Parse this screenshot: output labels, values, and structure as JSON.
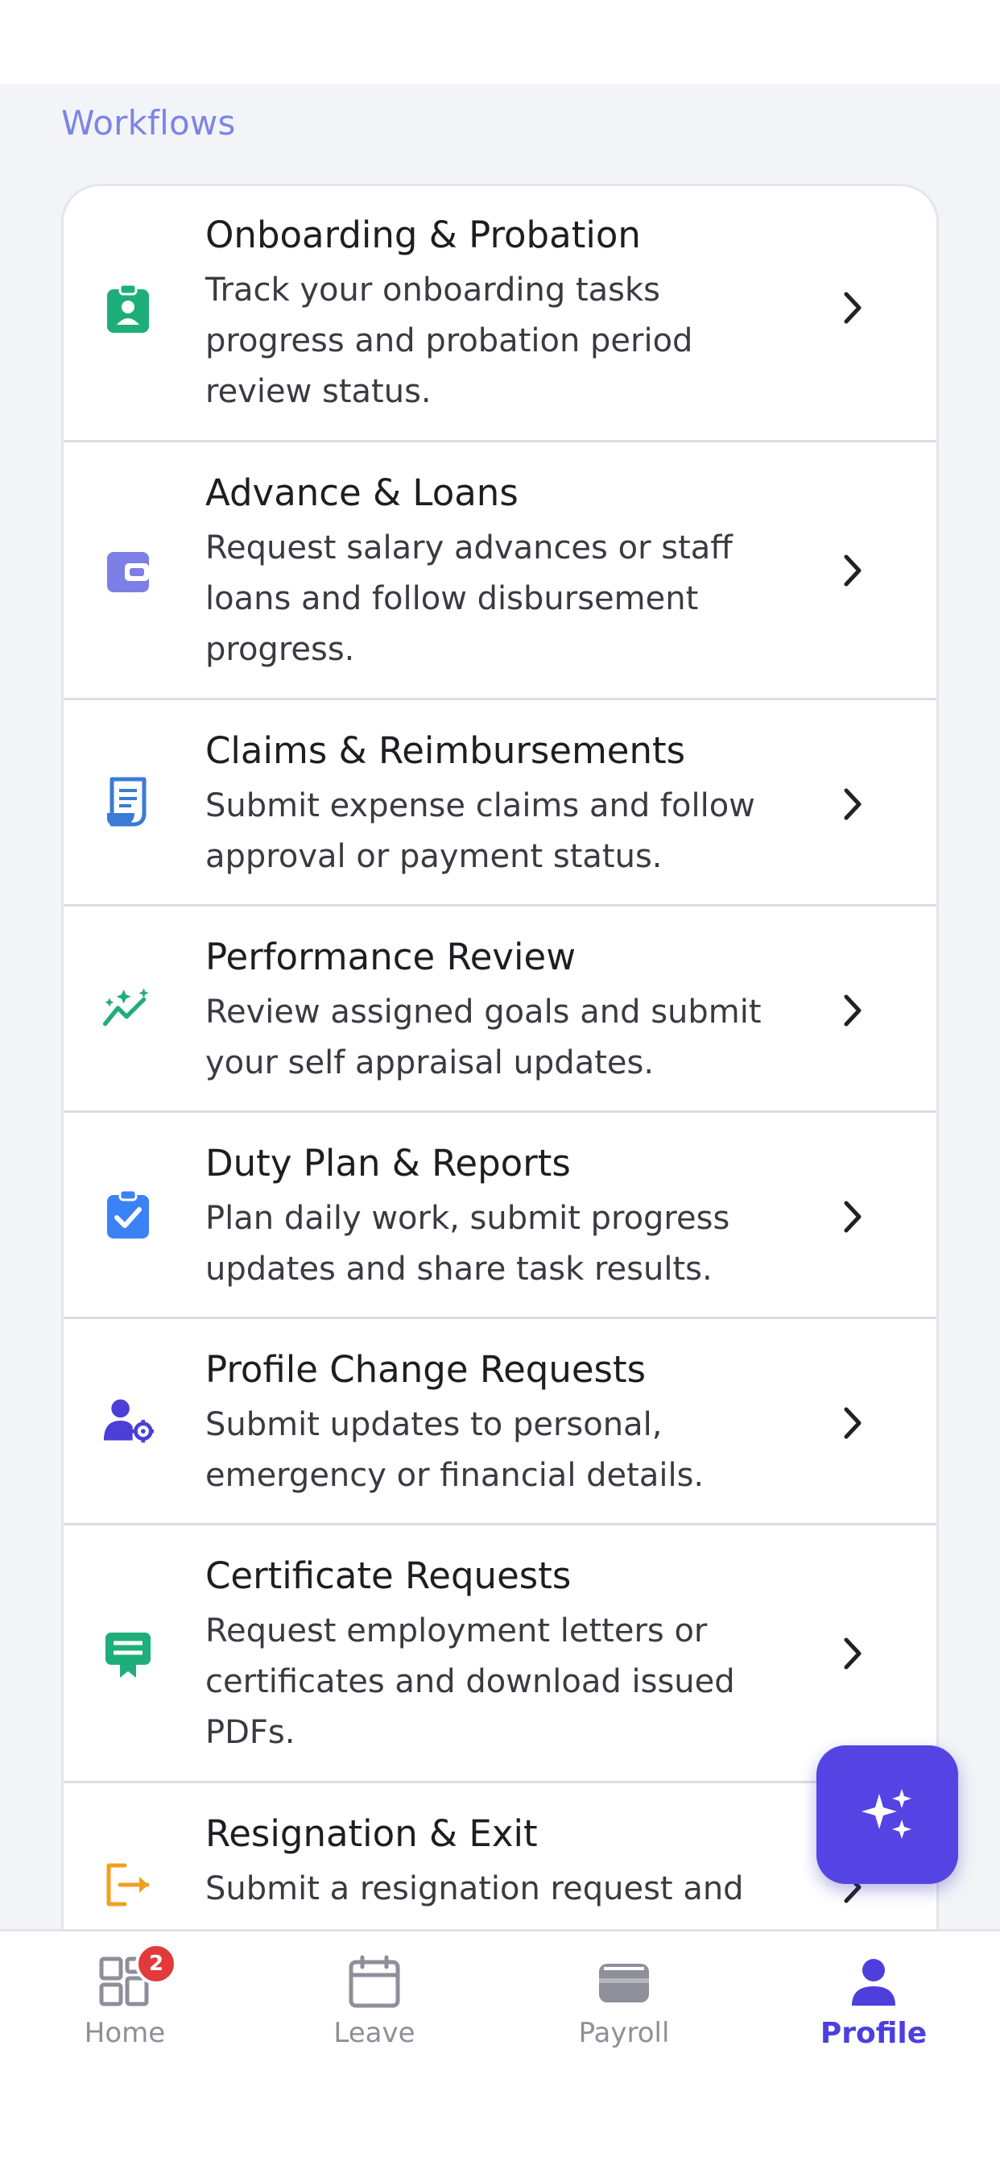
{
  "section": {
    "title": "Workflows"
  },
  "workflows": [
    {
      "title": "Onboarding & Probation",
      "description": "Track your onboarding tasks progress and probation period review status.",
      "icon": "clipboard-user-icon",
      "color": "#1eae7a"
    },
    {
      "title": "Advance & Loans",
      "description": "Request salary advances or staff loans and follow disbursement progress.",
      "icon": "wallet-icon",
      "color": "#7b7fe6"
    },
    {
      "title": "Claims & Reimbursements",
      "description": "Submit expense claims and follow approval or payment status.",
      "icon": "receipt-icon",
      "color": "#3a7bd5"
    },
    {
      "title": "Performance Review",
      "description": "Review assigned goals and submit your self appraisal updates.",
      "icon": "sparkle-trend-icon",
      "color": "#1eae7a"
    },
    {
      "title": "Duty Plan & Reports",
      "description": "Plan daily work, submit progress updates and share task results.",
      "icon": "clipboard-check-icon",
      "color": "#3b82f6"
    },
    {
      "title": "Profile Change Requests",
      "description": "Submit updates to personal, emergency or financial details.",
      "icon": "user-gear-icon",
      "color": "#4b3fd6"
    },
    {
      "title": "Certificate Requests",
      "description": "Request employment letters or certificates and download issued PDFs.",
      "icon": "certificate-icon",
      "color": "#1eae7a"
    },
    {
      "title": "Resignation & Exit",
      "description": "Submit a resignation request and",
      "icon": "exit-icon",
      "color": "#f0a020"
    }
  ],
  "fab": {
    "icon": "sparkles-icon"
  },
  "tabs": [
    {
      "label": "Home",
      "icon": "dashboard-icon",
      "badge": "2"
    },
    {
      "label": "Leave",
      "icon": "calendar-icon"
    },
    {
      "label": "Payroll",
      "icon": "wallet-icon"
    },
    {
      "label": "Profile",
      "icon": "user-icon",
      "active": true
    }
  ],
  "colors": {
    "accent": "#4c3fdc",
    "fab": "#5544e3",
    "badge": "#e23a3a"
  }
}
